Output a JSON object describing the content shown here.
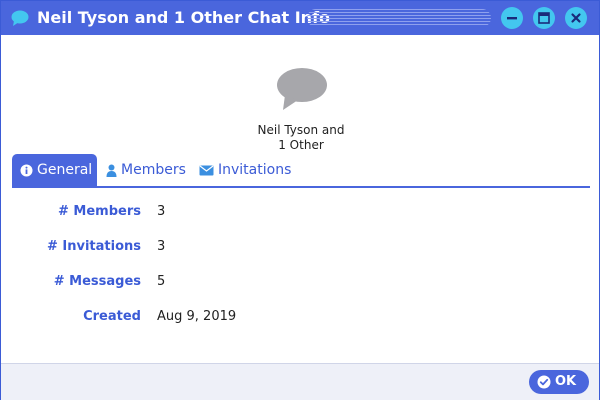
{
  "window": {
    "title": "Neil Tyson and 1 Other Chat Info",
    "accent_color": "#4a66dd",
    "button_color": "#43c7ef"
  },
  "chat": {
    "name_line1": "Neil Tyson and",
    "name_line2": "1 Other",
    "avatar_icon": "speech-bubble-icon"
  },
  "tabs": [
    {
      "label": "General",
      "icon": "info-circle-icon",
      "active": true
    },
    {
      "label": "Members",
      "icon": "user-icon",
      "active": false
    },
    {
      "label": "Invitations",
      "icon": "envelope-icon",
      "active": false
    }
  ],
  "info": [
    {
      "label": "# Members",
      "value": "3"
    },
    {
      "label": "# Invitations",
      "value": "3"
    },
    {
      "label": "# Messages",
      "value": "5"
    },
    {
      "label": "Created",
      "value": "Aug 9, 2019"
    }
  ],
  "footer": {
    "ok_label": "OK",
    "ok_icon": "check-circle-icon"
  }
}
